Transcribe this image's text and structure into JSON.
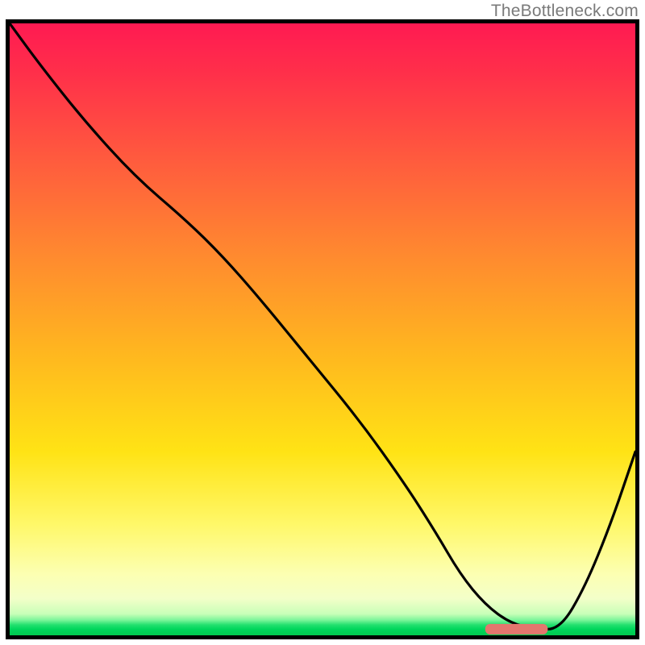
{
  "watermark": "TheBottleneck.com",
  "colors": {
    "frame": "#000000",
    "curve": "#000000",
    "marker": "#e4766e",
    "gradient_top": "#ff1a52",
    "gradient_bottom": "#00c94f"
  },
  "chart_data": {
    "type": "line",
    "title": "",
    "xlabel": "",
    "ylabel": "",
    "xlim": [
      0,
      100
    ],
    "ylim": [
      0,
      100
    ],
    "x": [
      0,
      5,
      12,
      20,
      28,
      34,
      40,
      48,
      56,
      63,
      68,
      72,
      76,
      80,
      84,
      88,
      92,
      96,
      100
    ],
    "values": [
      100,
      93,
      84,
      75,
      68,
      62,
      55,
      45,
      35,
      25,
      17,
      10,
      5,
      2,
      1,
      1,
      8,
      18,
      30
    ],
    "marker": {
      "x_start": 76,
      "x_end": 86,
      "y": 1
    },
    "annotations": []
  }
}
